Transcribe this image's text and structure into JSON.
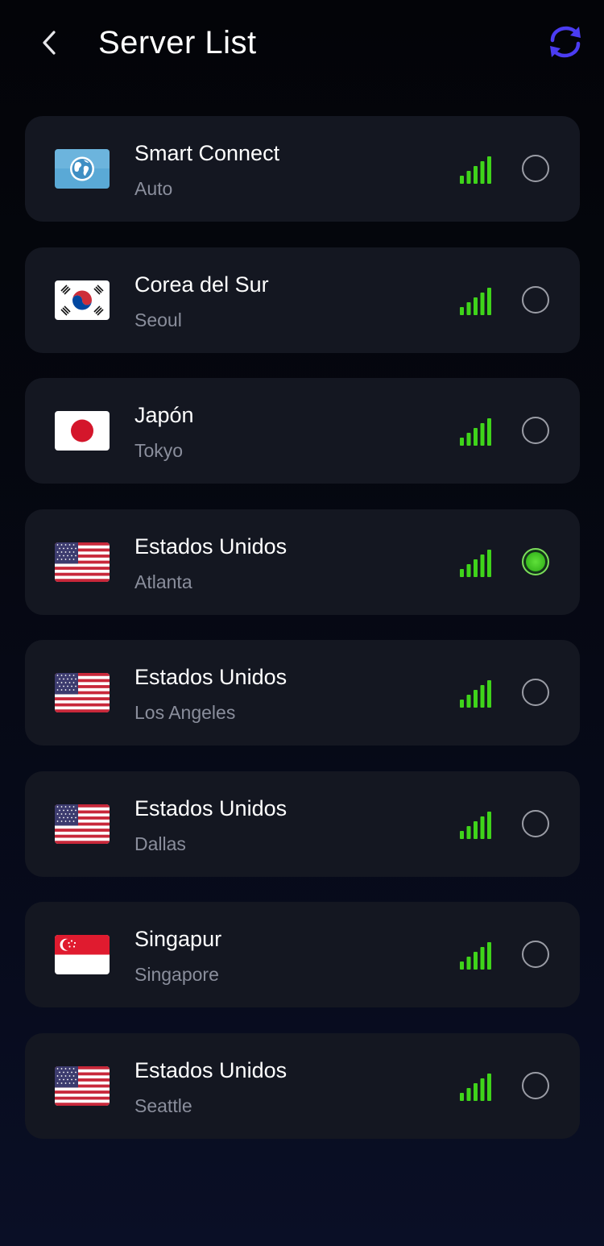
{
  "header": {
    "title": "Server List",
    "back_icon": "chevron-left-icon",
    "refresh_icon": "refresh-icon"
  },
  "colors": {
    "background": "#05070f",
    "card": "#141721",
    "signal": "#3fd41a",
    "radio_selected": "#3fd41a",
    "refresh_icon": "#4b3cf2",
    "secondary_text": "#8a8e9c"
  },
  "servers": [
    {
      "country": "Smart Connect",
      "city": "Auto",
      "flag": "globe-icon",
      "signal_bars": 5,
      "selected": false
    },
    {
      "country": "Corea del Sur",
      "city": "Seoul",
      "flag": "kr-flag-icon",
      "signal_bars": 5,
      "selected": false
    },
    {
      "country": "Japón",
      "city": "Tokyo",
      "flag": "jp-flag-icon",
      "signal_bars": 5,
      "selected": false
    },
    {
      "country": "Estados Unidos",
      "city": "Atlanta",
      "flag": "us-flag-icon",
      "signal_bars": 5,
      "selected": true
    },
    {
      "country": "Estados Unidos",
      "city": "Los Angeles",
      "flag": "us-flag-icon",
      "signal_bars": 5,
      "selected": false
    },
    {
      "country": "Estados Unidos",
      "city": "Dallas",
      "flag": "us-flag-icon",
      "signal_bars": 5,
      "selected": false
    },
    {
      "country": "Singapur",
      "city": "Singapore",
      "flag": "sg-flag-icon",
      "signal_bars": 5,
      "selected": false
    },
    {
      "country": "Estados Unidos",
      "city": "Seattle",
      "flag": "us-flag-icon",
      "signal_bars": 5,
      "selected": false
    }
  ]
}
